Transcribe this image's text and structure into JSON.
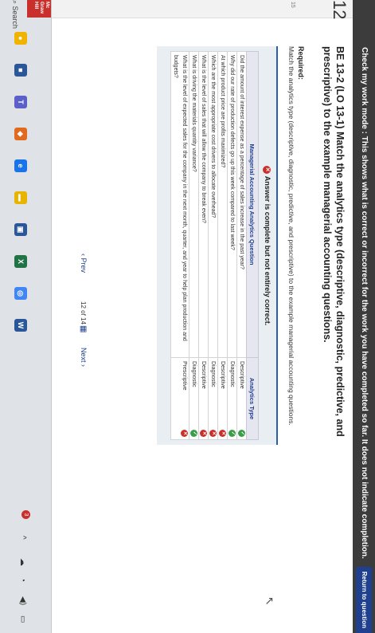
{
  "banner": {
    "text": "Check my work mode : This shows what is correct or incorrect for the work you have completed so far. It does not indicate completion.",
    "return_label": "Return to question"
  },
  "question": {
    "number": "12",
    "points": "15",
    "title": "BE 13-2 (LO 13-1) Match the analytics type (descriptive, diagnostic, predictive, and prescriptive) to the example managerial accounting questions.",
    "required_label": "Required:",
    "required_text": "Match the analytics type (descriptive, diagnostic, predictive, and prescriptive) to the example managerial accounting questions."
  },
  "answer": {
    "status": "Answer is complete but not entirely correct.",
    "col_question": "Managerial Accounting Analytics Question",
    "col_type": "Analytics Type",
    "rows": [
      {
        "q": "Did the amount of interest expense as a percentage of sales increase in the past year?",
        "a": "Descriptive",
        "ok": true
      },
      {
        "q": "Why did our rate of production defects go up this week compared to last week?",
        "a": "Diagnostic",
        "ok": true
      },
      {
        "q": "At which product price are profits maximized?",
        "a": "Descriptive",
        "ok": false
      },
      {
        "q": "Which are the most appropriate cost drivers to allocate overhead?",
        "a": "Diagnostic",
        "ok": false
      },
      {
        "q": "What is the level of sales that will allow the company to break even?",
        "a": "Descriptive",
        "ok": false
      },
      {
        "q": "What is driving the materials quantity variance?",
        "a": "Diagnostic",
        "ok": true
      },
      {
        "q": "What is the level of expected sales for the company in the next month, quarter, and year to help plan production and budgets?",
        "a": "Prescriptive",
        "ok": false
      }
    ]
  },
  "pager": {
    "prev": "Prev",
    "current": "12",
    "of": "of",
    "total": "14",
    "next": "Next"
  },
  "taskbar": {
    "brand": "Mc Graw Hill",
    "search": "Search",
    "notify_count": "3"
  },
  "colors": {
    "banner": "#3c3c3c",
    "accent": "#1f3f8f",
    "correct": "#3c9d4a",
    "incorrect": "#c9302c"
  }
}
